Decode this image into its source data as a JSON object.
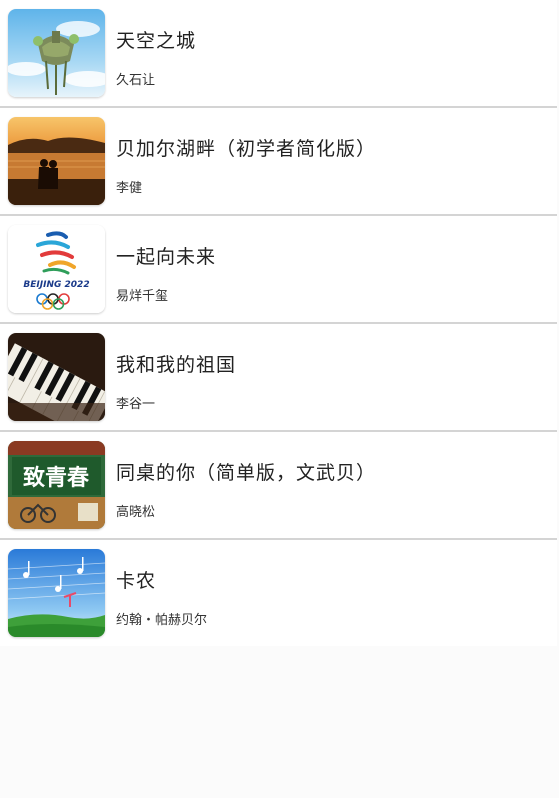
{
  "songs": [
    {
      "title": "天空之城",
      "artist": "久石让",
      "cover_icon": "castle-in-the-sky-cover"
    },
    {
      "title": "贝加尔湖畔（初学者简化版）",
      "artist": "李健",
      "cover_icon": "lake-sunset-cover"
    },
    {
      "title": "一起向未来",
      "artist": "易烊千玺",
      "cover_icon": "beijing-2022-cover",
      "cover_text": "BEIJING 2022"
    },
    {
      "title": "我和我的祖国",
      "artist": "李谷一",
      "cover_icon": "piano-keys-cover"
    },
    {
      "title": "同桌的你（简单版，文武贝）",
      "artist": "高晓松",
      "cover_icon": "youth-poster-cover",
      "cover_text": "致青春"
    },
    {
      "title": "卡农",
      "artist": "约翰・帕赫贝尔",
      "cover_icon": "canon-music-cover"
    }
  ],
  "colors": {
    "divider": "#d4d4d4",
    "title_text": "#222222",
    "artist_text": "#333333"
  }
}
